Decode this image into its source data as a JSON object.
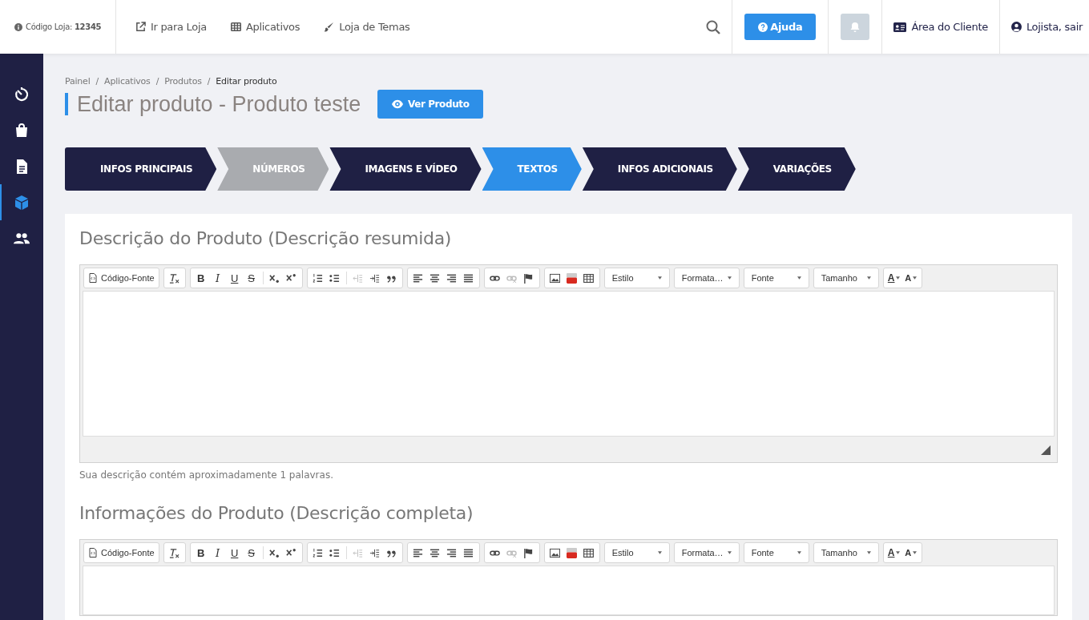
{
  "topbar": {
    "store_code": "Código Loja: **12345**",
    "links": [
      {
        "kind": "external",
        "label": "Ir para Loja"
      },
      {
        "kind": "grid",
        "label": "Aplicativos"
      },
      {
        "kind": "brush",
        "label": "Loja de Temas"
      }
    ],
    "help_button": "Ajuda",
    "client_area": "Área do Cliente",
    "user": "Lojista, sair"
  },
  "sidebar": {
    "items": [
      {
        "kind": "timer",
        "selected": false
      },
      {
        "kind": "bag",
        "selected": false
      },
      {
        "kind": "document",
        "selected": false
      },
      {
        "kind": "cube",
        "selected": true
      },
      {
        "kind": "people",
        "selected": false
      }
    ]
  },
  "breadcrumb": [
    {
      "label": "Painel",
      "current": false
    },
    {
      "sep": "/",
      "label": "Aplicativos",
      "current": false
    },
    {
      "sep": "/",
      "label": "Produtos",
      "current": false
    },
    {
      "sep": "/",
      "label": "Editar produto",
      "current": true
    }
  ],
  "page_title": "Editar produto - Produto teste",
  "view_button": "Ver Produto",
  "steps": [
    {
      "label": "INFOS PRINCIPAIS",
      "selected": false,
      "disabled": false
    },
    {
      "label": "NÚMEROS",
      "selected": false,
      "disabled": true
    },
    {
      "label": "IMAGENS E VÍDEO",
      "selected": false,
      "disabled": false
    },
    {
      "label": "TEXTOS",
      "selected": true,
      "disabled": false
    },
    {
      "label": "INFOS ADICIONAIS",
      "selected": false,
      "disabled": false
    },
    {
      "label": "VARIAÇÕES",
      "selected": false,
      "disabled": false
    }
  ],
  "editors": [
    {
      "heading": "Descrição do Produto (Descrição resumida)",
      "word_count": "Sua descrição contém aproximadamente 1 palavras.",
      "toolbar": [
        [
          [
            {
              "kind": "source",
              "label": "Código-Fonte",
              "disabled": false
            }
          ]
        ],
        [
          [
            {
              "kind": "removeformat",
              "disabled": false
            }
          ]
        ],
        [
          [
            {
              "kind": "bold",
              "label": "B",
              "disabled": false
            },
            {
              "kind": "italic",
              "label": "I",
              "disabled": false
            },
            {
              "kind": "underline",
              "label": "U",
              "disabled": false
            },
            {
              "kind": "strike",
              "label": "S",
              "disabled": false
            }
          ],
          [
            {
              "kind": "subscript",
              "disabled": false
            },
            {
              "kind": "superscript",
              "disabled": false
            }
          ]
        ],
        [
          [
            {
              "kind": "ol",
              "disabled": false
            },
            {
              "kind": "ul",
              "disabled": false
            }
          ],
          [
            {
              "kind": "outdent",
              "disabled": true
            },
            {
              "kind": "indent",
              "disabled": false
            },
            {
              "kind": "quote",
              "disabled": false
            }
          ]
        ],
        [
          [
            {
              "kind": "left",
              "disabled": false
            },
            {
              "kind": "center",
              "disabled": false
            },
            {
              "kind": "right",
              "disabled": false
            },
            {
              "kind": "justify",
              "disabled": false
            }
          ]
        ],
        [
          [
            {
              "kind": "link",
              "disabled": false
            },
            {
              "kind": "unlink",
              "disabled": true
            },
            {
              "kind": "anchor",
              "disabled": false
            }
          ]
        ],
        [
          [
            {
              "kind": "image",
              "disabled": false
            },
            {
              "kind": "youtube",
              "disabled": false
            },
            {
              "kind": "table",
              "disabled": false
            }
          ]
        ],
        [
          [
            {
              "kind": "combo",
              "label": "Estilo",
              "disabled": false
            }
          ]
        ],
        [
          [
            {
              "kind": "combo",
              "label": "Formata…",
              "disabled": false
            }
          ]
        ],
        [
          [
            {
              "kind": "combo",
              "label": "Fonte",
              "disabled": false
            }
          ]
        ],
        [
          [
            {
              "kind": "combo",
              "label": "Tamanho",
              "disabled": false
            }
          ]
        ],
        [
          [
            {
              "kind": "textcolor",
              "label": "A",
              "disabled": false
            },
            {
              "kind": "bgcolor",
              "label": "A",
              "disabled": false
            }
          ]
        ]
      ]
    },
    {
      "heading": "Informações do Produto (Descrição completa)",
      "toolbar": [
        [
          [
            {
              "kind": "source",
              "label": "Código-Fonte",
              "disabled": false
            }
          ]
        ],
        [
          [
            {
              "kind": "removeformat",
              "disabled": false
            }
          ]
        ],
        [
          [
            {
              "kind": "bold",
              "label": "B",
              "disabled": false
            },
            {
              "kind": "italic",
              "label": "I",
              "disabled": false
            },
            {
              "kind": "underline",
              "label": "U",
              "disabled": false
            },
            {
              "kind": "strike",
              "label": "S",
              "disabled": false
            }
          ],
          [
            {
              "kind": "subscript",
              "disabled": false
            },
            {
              "kind": "superscript",
              "disabled": false
            }
          ]
        ],
        [
          [
            {
              "kind": "ol",
              "disabled": false
            },
            {
              "kind": "ul",
              "disabled": false
            }
          ],
          [
            {
              "kind": "outdent",
              "disabled": true
            },
            {
              "kind": "indent",
              "disabled": false
            },
            {
              "kind": "quote",
              "disabled": false
            }
          ]
        ],
        [
          [
            {
              "kind": "left",
              "disabled": false
            },
            {
              "kind": "center",
              "disabled": false
            },
            {
              "kind": "right",
              "disabled": false
            },
            {
              "kind": "justify",
              "disabled": false
            }
          ]
        ],
        [
          [
            {
              "kind": "link",
              "disabled": false
            },
            {
              "kind": "unlink",
              "disabled": true
            },
            {
              "kind": "anchor",
              "disabled": false
            }
          ]
        ],
        [
          [
            {
              "kind": "image",
              "disabled": false
            },
            {
              "kind": "youtube",
              "disabled": false
            },
            {
              "kind": "table",
              "disabled": false
            }
          ]
        ],
        [
          [
            {
              "kind": "combo",
              "label": "Estilo",
              "disabled": false
            }
          ]
        ],
        [
          [
            {
              "kind": "combo",
              "label": "Formata…",
              "disabled": false
            }
          ]
        ],
        [
          [
            {
              "kind": "combo",
              "label": "Fonte",
              "disabled": false
            }
          ]
        ],
        [
          [
            {
              "kind": "combo",
              "label": "Tamanho",
              "disabled": false
            }
          ]
        ],
        [
          [
            {
              "kind": "textcolor",
              "label": "A",
              "disabled": false
            },
            {
              "kind": "bgcolor",
              "label": "A",
              "disabled": false
            }
          ]
        ]
      ]
    }
  ]
}
